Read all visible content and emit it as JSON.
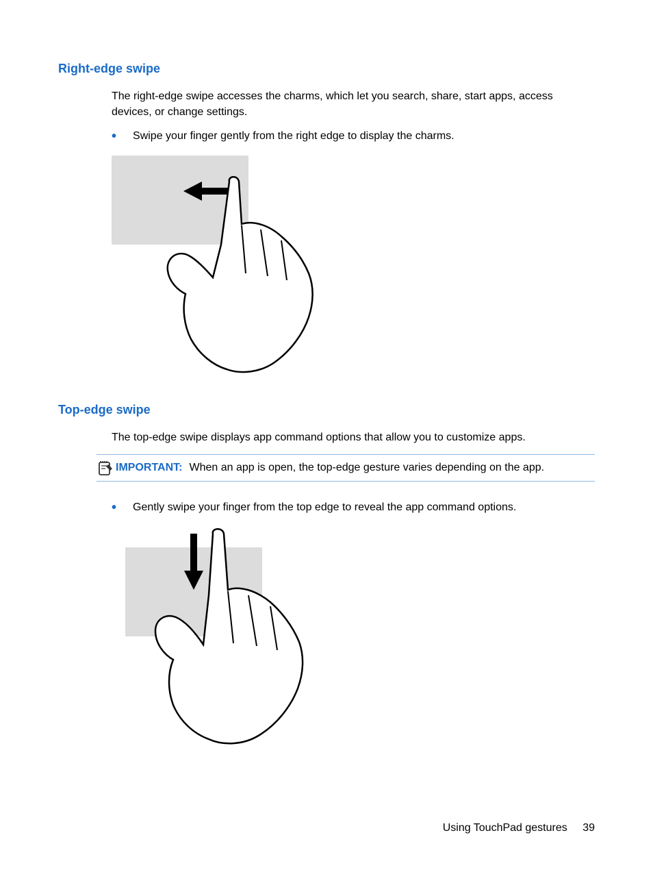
{
  "section1": {
    "heading": "Right-edge swipe",
    "intro": "The right-edge swipe accesses the charms, which let you search, share, start apps, access devices, or change settings.",
    "bullet": "Swipe your finger gently from the right edge to display the charms."
  },
  "section2": {
    "heading": "Top-edge swipe",
    "intro": "The top-edge swipe displays app command options that allow you to customize apps.",
    "note_label": "IMPORTANT:",
    "note_text": "When an app is open, the top-edge gesture varies depending on the app.",
    "bullet": "Gently swipe your finger from the top edge to reveal the app command options."
  },
  "footer": {
    "title": "Using TouchPad gestures",
    "page": "39"
  }
}
